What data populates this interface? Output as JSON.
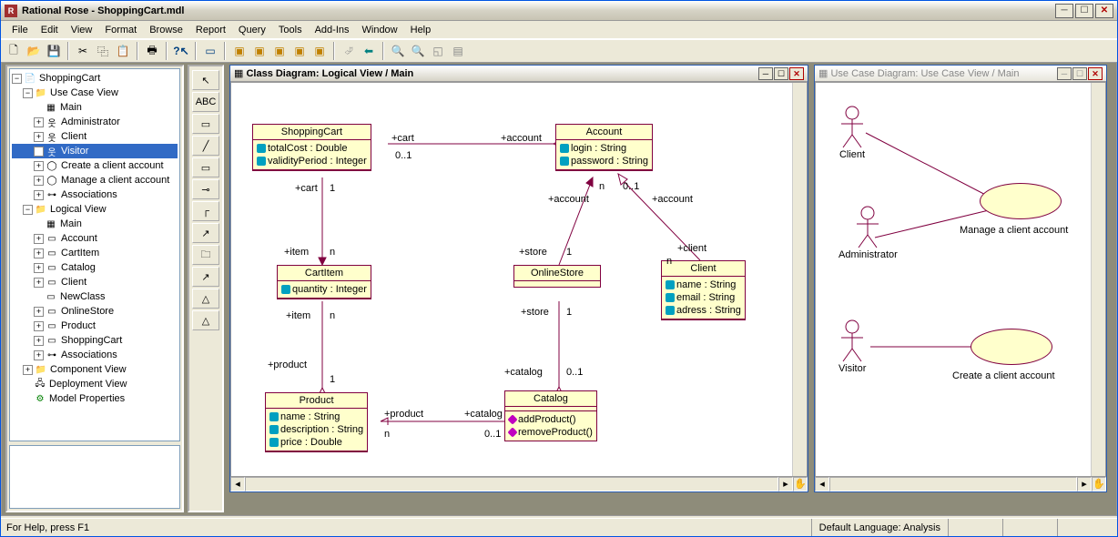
{
  "app": {
    "title": "Rational Rose - ShoppingCart.mdl"
  },
  "menu": {
    "items": [
      "File",
      "Edit",
      "View",
      "Format",
      "Browse",
      "Report",
      "Query",
      "Tools",
      "Add-Ins",
      "Window",
      "Help"
    ]
  },
  "tree": {
    "root": "ShoppingCart",
    "ucv": "Use Case View",
    "ucv_items": [
      "Main",
      "Administrator",
      "Client",
      "Visitor",
      "Create a client account",
      "Manage a client account",
      "Associations"
    ],
    "lv": "Logical View",
    "lv_items": [
      "Main",
      "Account",
      "CartItem",
      "Catalog",
      "Client",
      "NewClass",
      "OnlineStore",
      "Product",
      "ShoppingCart",
      "Associations"
    ],
    "cv": "Component View",
    "dv": "Deployment View",
    "mp": "Model Properties"
  },
  "diag1": {
    "title": "Class Diagram: Logical View / Main",
    "classes": {
      "ShoppingCart": {
        "name": "ShoppingCart",
        "attrs": [
          "totalCost : Double",
          "validityPeriod : Integer"
        ]
      },
      "Account": {
        "name": "Account",
        "attrs": [
          "login : String",
          "password : String"
        ]
      },
      "CartItem": {
        "name": "CartItem",
        "attrs": [
          "quantity : Integer"
        ]
      },
      "OnlineStore": {
        "name": "OnlineStore"
      },
      "Client": {
        "name": "Client",
        "attrs": [
          "name : String",
          "email : String",
          "adress : String"
        ]
      },
      "Product": {
        "name": "Product",
        "attrs": [
          "name : String",
          "description : String",
          "price : Double"
        ]
      },
      "Catalog": {
        "name": "Catalog",
        "ops": [
          "addProduct()",
          "removeProduct()"
        ]
      }
    },
    "labels": {
      "cart_role": "+cart",
      "cart_mul": "0..1",
      "account_role": "+account",
      "sc_cart_role": "+cart",
      "sc_cart_mul": "1",
      "item_role": "+item",
      "item_mul": "n",
      "ci_item_role": "+item",
      "ci_item_mul": "n",
      "product_role": "+product",
      "product_mul": "1",
      "p_product_role": "+product",
      "p_product_mul": "n",
      "catalog_role": "+catalog",
      "catalog_mul": "0..1",
      "p_catalog_role": "+catalog",
      "p_catalog_mul": "0..1",
      "store_role": "+store",
      "store_mul": "1",
      "os_store_role": "+store",
      "os_store_mul": "1",
      "a_account_role": "+account",
      "a_account_mul": "n",
      "a2_account_role": "+account",
      "a2_account_mul": "0..1",
      "client_role": "+client",
      "client_mul": "n"
    }
  },
  "diag2": {
    "title": "Use Case Diagram: Use Case View / Main",
    "actors": {
      "client": "Client",
      "admin": "Administrator",
      "visitor": "Visitor"
    },
    "usecases": {
      "manage": "Manage a client account",
      "create": "Create a client account"
    }
  },
  "status": {
    "help": "For Help, press F1",
    "lang": "Default Language: Analysis"
  },
  "toolbox": {
    "abc": "ABC"
  }
}
